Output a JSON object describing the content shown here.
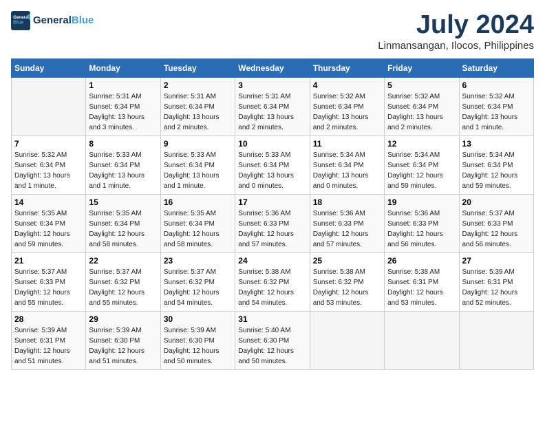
{
  "logo": {
    "line1": "General",
    "line2": "Blue"
  },
  "title": "July 2024",
  "subtitle": "Linmansangan, Ilocos, Philippines",
  "headers": [
    "Sunday",
    "Monday",
    "Tuesday",
    "Wednesday",
    "Thursday",
    "Friday",
    "Saturday"
  ],
  "weeks": [
    [
      {
        "day": "",
        "info": ""
      },
      {
        "day": "1",
        "info": "Sunrise: 5:31 AM\nSunset: 6:34 PM\nDaylight: 13 hours\nand 3 minutes."
      },
      {
        "day": "2",
        "info": "Sunrise: 5:31 AM\nSunset: 6:34 PM\nDaylight: 13 hours\nand 2 minutes."
      },
      {
        "day": "3",
        "info": "Sunrise: 5:31 AM\nSunset: 6:34 PM\nDaylight: 13 hours\nand 2 minutes."
      },
      {
        "day": "4",
        "info": "Sunrise: 5:32 AM\nSunset: 6:34 PM\nDaylight: 13 hours\nand 2 minutes."
      },
      {
        "day": "5",
        "info": "Sunrise: 5:32 AM\nSunset: 6:34 PM\nDaylight: 13 hours\nand 2 minutes."
      },
      {
        "day": "6",
        "info": "Sunrise: 5:32 AM\nSunset: 6:34 PM\nDaylight: 13 hours\nand 1 minute."
      }
    ],
    [
      {
        "day": "7",
        "info": "Sunrise: 5:32 AM\nSunset: 6:34 PM\nDaylight: 13 hours\nand 1 minute."
      },
      {
        "day": "8",
        "info": "Sunrise: 5:33 AM\nSunset: 6:34 PM\nDaylight: 13 hours\nand 1 minute."
      },
      {
        "day": "9",
        "info": "Sunrise: 5:33 AM\nSunset: 6:34 PM\nDaylight: 13 hours\nand 1 minute."
      },
      {
        "day": "10",
        "info": "Sunrise: 5:33 AM\nSunset: 6:34 PM\nDaylight: 13 hours\nand 0 minutes."
      },
      {
        "day": "11",
        "info": "Sunrise: 5:34 AM\nSunset: 6:34 PM\nDaylight: 13 hours\nand 0 minutes."
      },
      {
        "day": "12",
        "info": "Sunrise: 5:34 AM\nSunset: 6:34 PM\nDaylight: 12 hours\nand 59 minutes."
      },
      {
        "day": "13",
        "info": "Sunrise: 5:34 AM\nSunset: 6:34 PM\nDaylight: 12 hours\nand 59 minutes."
      }
    ],
    [
      {
        "day": "14",
        "info": "Sunrise: 5:35 AM\nSunset: 6:34 PM\nDaylight: 12 hours\nand 59 minutes."
      },
      {
        "day": "15",
        "info": "Sunrise: 5:35 AM\nSunset: 6:34 PM\nDaylight: 12 hours\nand 58 minutes."
      },
      {
        "day": "16",
        "info": "Sunrise: 5:35 AM\nSunset: 6:34 PM\nDaylight: 12 hours\nand 58 minutes."
      },
      {
        "day": "17",
        "info": "Sunrise: 5:36 AM\nSunset: 6:33 PM\nDaylight: 12 hours\nand 57 minutes."
      },
      {
        "day": "18",
        "info": "Sunrise: 5:36 AM\nSunset: 6:33 PM\nDaylight: 12 hours\nand 57 minutes."
      },
      {
        "day": "19",
        "info": "Sunrise: 5:36 AM\nSunset: 6:33 PM\nDaylight: 12 hours\nand 56 minutes."
      },
      {
        "day": "20",
        "info": "Sunrise: 5:37 AM\nSunset: 6:33 PM\nDaylight: 12 hours\nand 56 minutes."
      }
    ],
    [
      {
        "day": "21",
        "info": "Sunrise: 5:37 AM\nSunset: 6:33 PM\nDaylight: 12 hours\nand 55 minutes."
      },
      {
        "day": "22",
        "info": "Sunrise: 5:37 AM\nSunset: 6:32 PM\nDaylight: 12 hours\nand 55 minutes."
      },
      {
        "day": "23",
        "info": "Sunrise: 5:37 AM\nSunset: 6:32 PM\nDaylight: 12 hours\nand 54 minutes."
      },
      {
        "day": "24",
        "info": "Sunrise: 5:38 AM\nSunset: 6:32 PM\nDaylight: 12 hours\nand 54 minutes."
      },
      {
        "day": "25",
        "info": "Sunrise: 5:38 AM\nSunset: 6:32 PM\nDaylight: 12 hours\nand 53 minutes."
      },
      {
        "day": "26",
        "info": "Sunrise: 5:38 AM\nSunset: 6:31 PM\nDaylight: 12 hours\nand 53 minutes."
      },
      {
        "day": "27",
        "info": "Sunrise: 5:39 AM\nSunset: 6:31 PM\nDaylight: 12 hours\nand 52 minutes."
      }
    ],
    [
      {
        "day": "28",
        "info": "Sunrise: 5:39 AM\nSunset: 6:31 PM\nDaylight: 12 hours\nand 51 minutes."
      },
      {
        "day": "29",
        "info": "Sunrise: 5:39 AM\nSunset: 6:30 PM\nDaylight: 12 hours\nand 51 minutes."
      },
      {
        "day": "30",
        "info": "Sunrise: 5:39 AM\nSunset: 6:30 PM\nDaylight: 12 hours\nand 50 minutes."
      },
      {
        "day": "31",
        "info": "Sunrise: 5:40 AM\nSunset: 6:30 PM\nDaylight: 12 hours\nand 50 minutes."
      },
      {
        "day": "",
        "info": ""
      },
      {
        "day": "",
        "info": ""
      },
      {
        "day": "",
        "info": ""
      }
    ]
  ]
}
